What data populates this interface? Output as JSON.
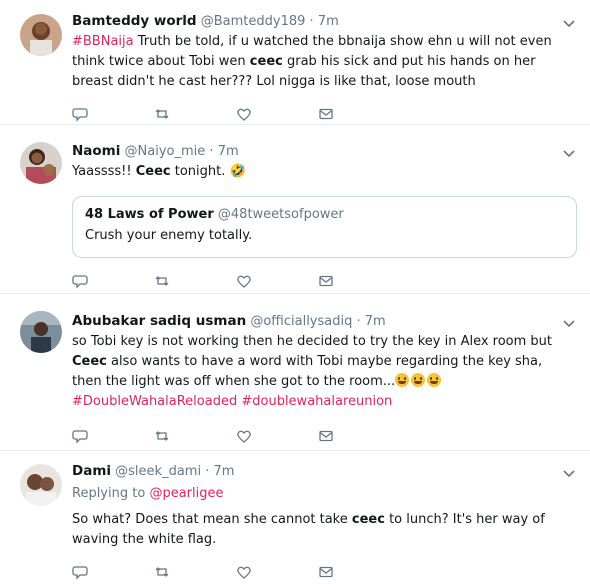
{
  "tweets": [
    {
      "name": "Bamteddy world",
      "handle": "@Bamteddy189",
      "time": "7m",
      "text_parts": {
        "hashtag": "#BBNaija",
        "t1": " Truth be told, if u watched the bbnaija show ehn u will not even think twice about Tobi wen ",
        "bold": "ceec",
        "t2": " grab his sick and put his hands on her breast didn't he cast her???  Lol nigga is like that, loose mouth"
      }
    },
    {
      "name": "Naomi",
      "handle": "@Naiyo_mie",
      "time": "7m",
      "text_parts": {
        "t1": "Yaassss!! ",
        "bold": "Ceec",
        "t2": " tonight. 🤣"
      },
      "quote": {
        "name": "48 Laws of Power",
        "handle": "@48tweetsofpower",
        "text": "Crush your enemy totally."
      }
    },
    {
      "name": "Abubakar sadiq usman",
      "handle": "@officiallysadiq",
      "time": "7m",
      "text_parts": {
        "t1": "so Tobi key is not working then he decided to try the key in Alex room but ",
        "bold": "Ceec",
        "t2": " also wants to have a word with Tobi maybe regarding the key sha, then the light was off when she got to the room...",
        "hashtag1": "#DoubleWahalaReloaded",
        "hashtag2": "#doublewahalareunion"
      }
    },
    {
      "name": "Dami",
      "handle": "@sleek_dami",
      "time": "7m",
      "replying_label": "Replying to ",
      "replying_to": "@pearligee",
      "text_parts": {
        "t1": "So what? Does that mean she cannot take ",
        "bold": "ceec",
        "t2": " to lunch? It's her way of waving the white flag."
      }
    }
  ],
  "icons": {
    "reply": "reply-icon",
    "retweet": "retweet-icon",
    "like": "heart-icon",
    "dm": "envelope-icon",
    "caret": "chevron-down-icon"
  },
  "colors": {
    "hashtag": "#e0245e",
    "muted": "#657786",
    "divider": "#e6ecf0"
  }
}
